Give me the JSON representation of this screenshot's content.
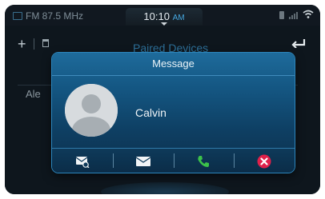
{
  "status_bar": {
    "radio": "FM 87.5 MHz",
    "time": "10:10",
    "ampm": "AM"
  },
  "background": {
    "title": "Paired Devices",
    "row_partial_text": "Ale"
  },
  "dialog": {
    "title": "Message",
    "contact_name": "Calvin",
    "actions": [
      {
        "icon": "view-message-icon"
      },
      {
        "icon": "reply-message-icon"
      },
      {
        "icon": "call-icon"
      },
      {
        "icon": "close-icon"
      }
    ]
  },
  "colors": {
    "accent": "#46a8e0",
    "call_green": "#3cc24a",
    "close_red": "#e0204a"
  }
}
